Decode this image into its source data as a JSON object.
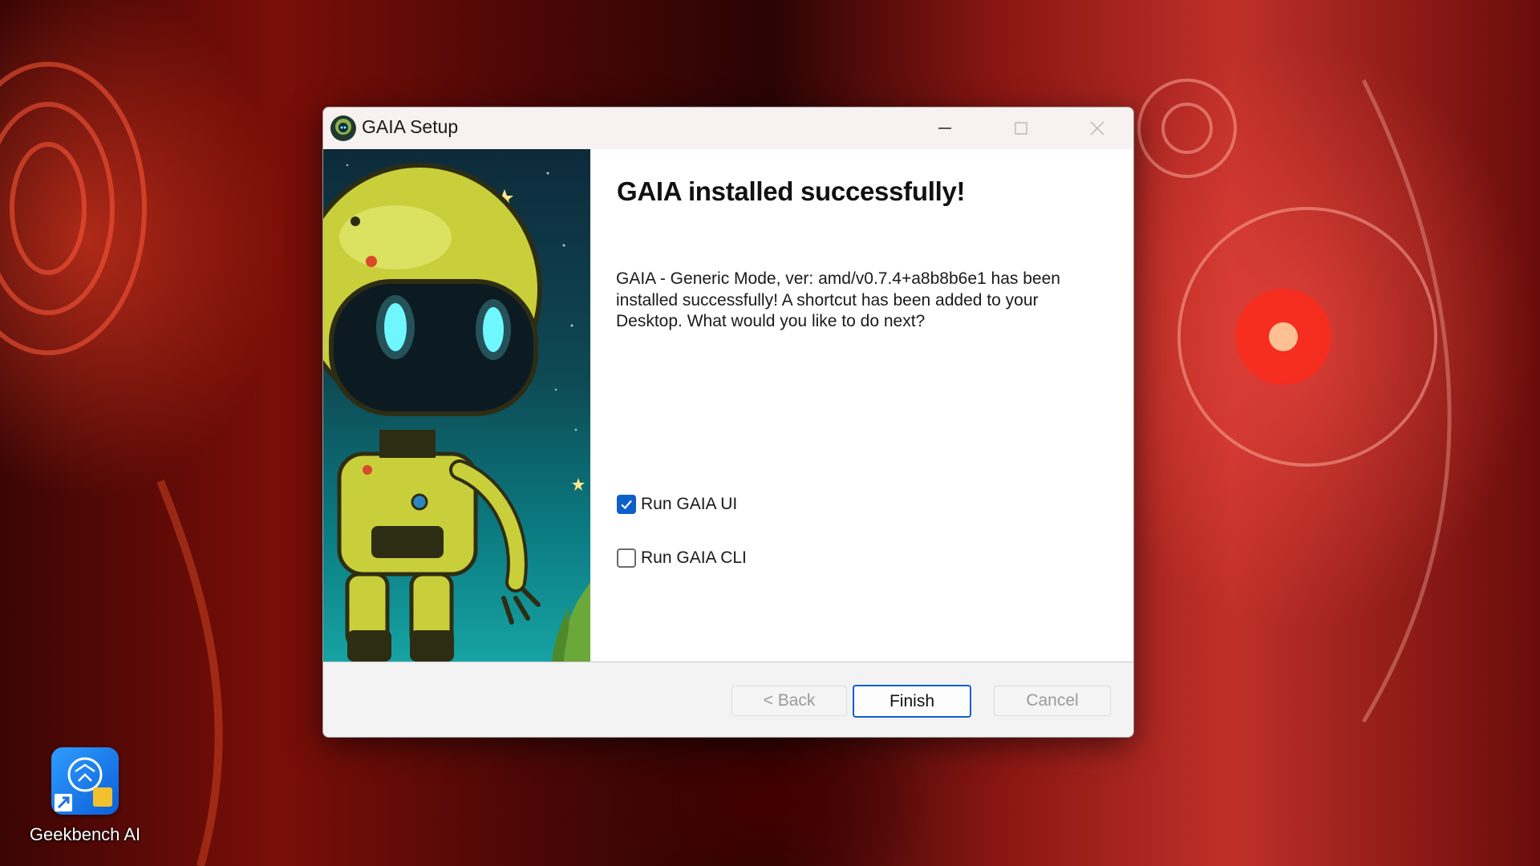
{
  "window": {
    "title": "GAIA Setup"
  },
  "content": {
    "heading": "GAIA installed successfully!",
    "message": "GAIA - Generic Mode, ver: amd/v0.7.4+a8b8b6e1 has been installed successfully! A shortcut has been added to your Desktop. What would you like to do next?",
    "options": [
      {
        "label": "Run GAIA UI",
        "checked": true
      },
      {
        "label": "Run GAIA CLI",
        "checked": false
      }
    ]
  },
  "buttons": {
    "back": "< Back",
    "finish": "Finish",
    "cancel": "Cancel"
  },
  "desktop": {
    "icons": [
      {
        "label": "Geekbench AI",
        "icon": "geekbench-ai-icon"
      }
    ]
  },
  "colors": {
    "accent": "#0f5fc9",
    "robot_body": "#c9cf3a",
    "robot_eyes": "#6ff7ff",
    "panel_bg": "#0e4a54"
  }
}
